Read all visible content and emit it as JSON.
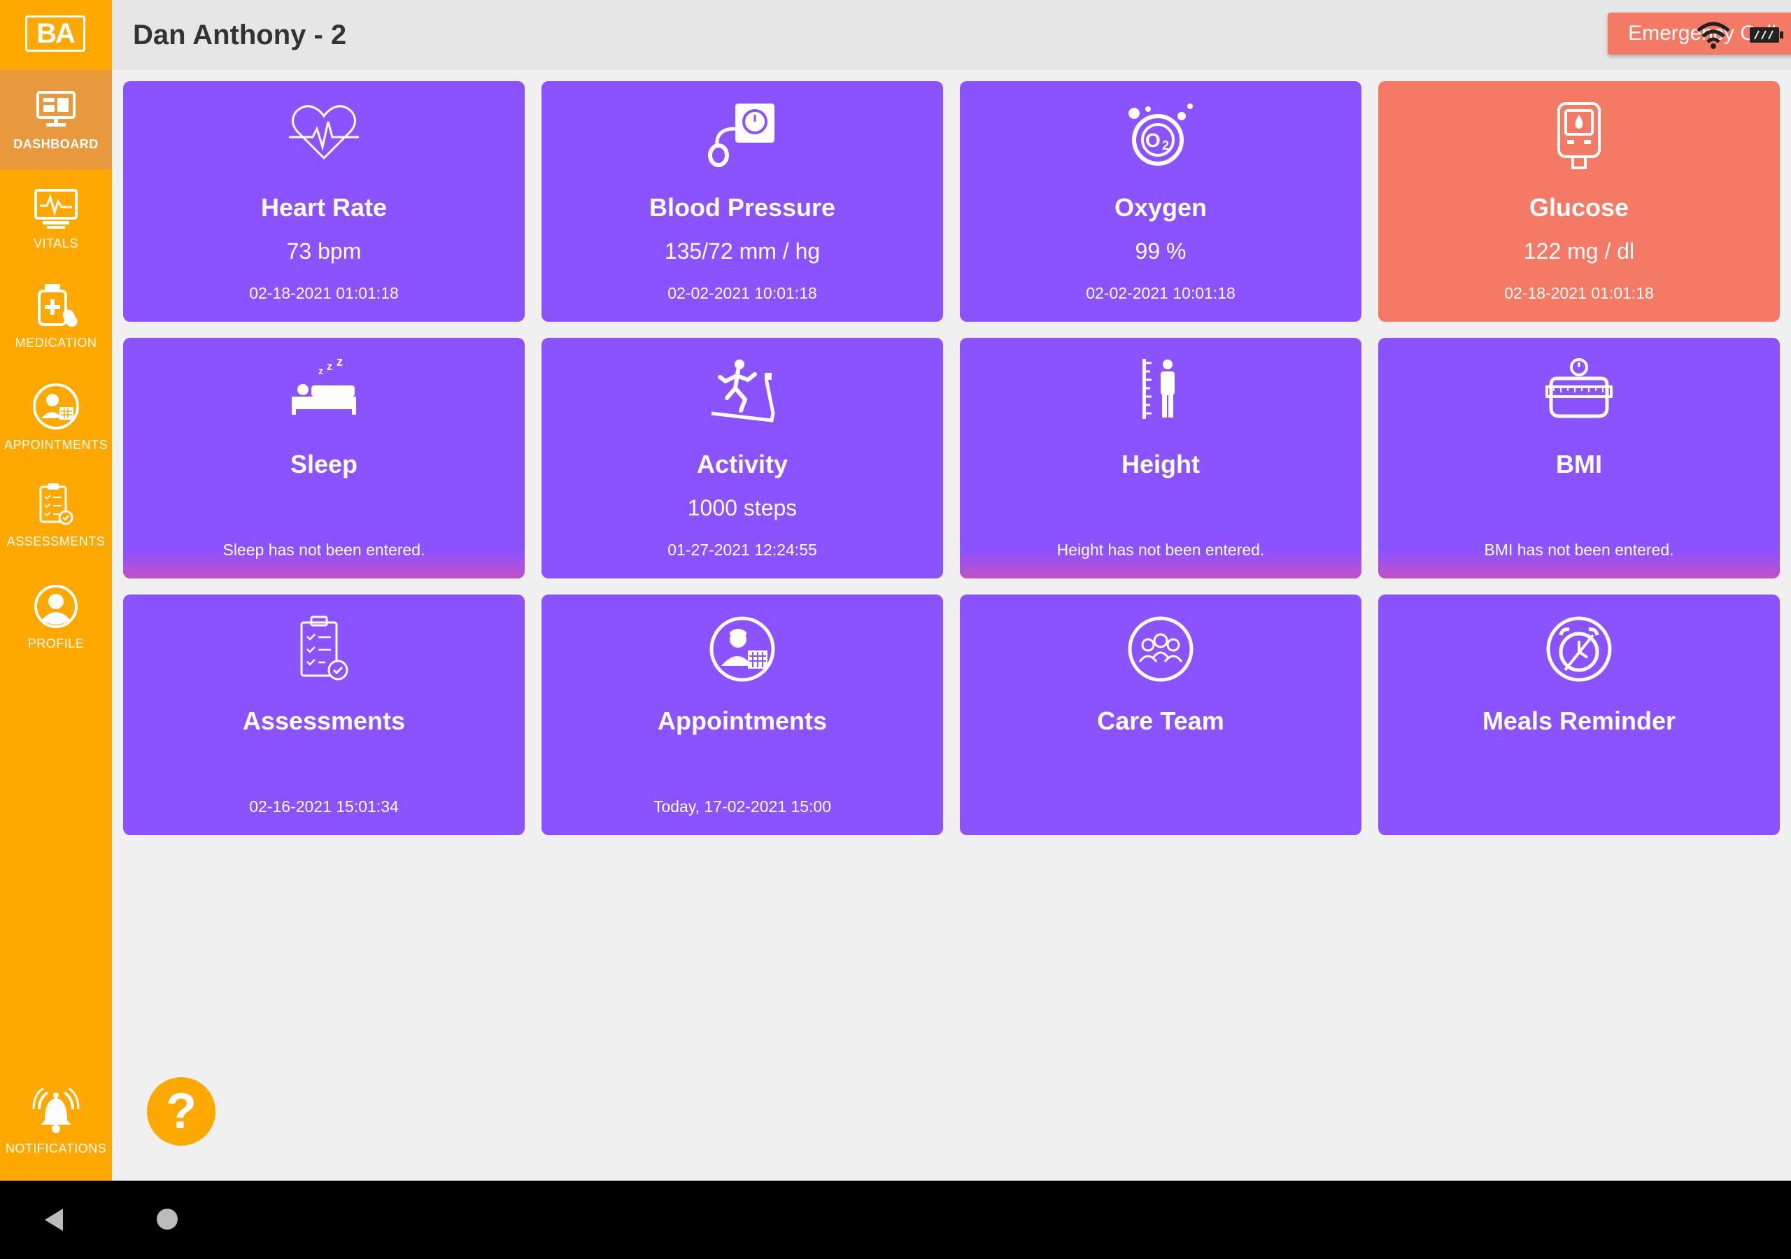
{
  "app": {
    "logo": "BA"
  },
  "header": {
    "title": "Dan Anthony - 2",
    "emergency_label": "Emergency Call"
  },
  "sidebar": {
    "items": [
      {
        "label": "DASHBOARD",
        "icon": "monitor-icon",
        "active": true
      },
      {
        "label": "VITALS",
        "icon": "vitals-monitor-icon",
        "active": false
      },
      {
        "label": "MEDICATION",
        "icon": "medication-icon",
        "active": false
      },
      {
        "label": "APPOINTMENTS",
        "icon": "doctor-calendar-icon",
        "active": false
      },
      {
        "label": "ASSESSMENTS",
        "icon": "clipboard-check-icon",
        "active": false
      },
      {
        "label": "PROFILE",
        "icon": "user-icon",
        "active": false
      }
    ],
    "notifications_label": "NOTIFICATIONS"
  },
  "cards": [
    {
      "title": "Heart Rate",
      "value": "73 bpm",
      "time": "02-18-2021 01:01:18",
      "icon": "heart-pulse-icon"
    },
    {
      "title": "Blood Pressure",
      "value": "135/72 mm / hg",
      "time": "02-02-2021 10:01:18",
      "icon": "blood-pressure-icon"
    },
    {
      "title": "Oxygen",
      "value": "99 %",
      "time": "02-02-2021 10:01:18",
      "icon": "oxygen-icon"
    },
    {
      "title": "Glucose",
      "value": "122 mg / dl",
      "time": "02-18-2021 01:01:18",
      "icon": "glucometer-icon",
      "alert": true
    },
    {
      "title": "Sleep",
      "value": "",
      "time": "Sleep has not been entered.",
      "icon": "bed-icon"
    },
    {
      "title": "Activity",
      "value": "1000 steps",
      "time": "01-27-2021 12:24:55",
      "icon": "treadmill-icon"
    },
    {
      "title": "Height",
      "value": "",
      "time": "Height has not been entered.",
      "icon": "height-icon"
    },
    {
      "title": "BMI",
      "value": "",
      "time": "BMI has not been entered.",
      "icon": "scale-icon"
    },
    {
      "title": "Assessments",
      "value": "",
      "time": "02-16-2021 15:01:34",
      "icon": "clipboard-check-icon"
    },
    {
      "title": "Appointments",
      "value": "",
      "time": "Today, 17-02-2021 15:00",
      "icon": "doctor-calendar-icon"
    },
    {
      "title": "Care Team",
      "value": "",
      "time": "",
      "icon": "care-team-icon"
    },
    {
      "title": "Meals Reminder",
      "value": "",
      "time": "",
      "icon": "alarm-clock-icon"
    }
  ],
  "help": {
    "label": "?"
  },
  "colors": {
    "sidebar": "#FFA800",
    "card": "#8B52FF",
    "alert": "#F57A66",
    "emergency": "#F47A65"
  }
}
